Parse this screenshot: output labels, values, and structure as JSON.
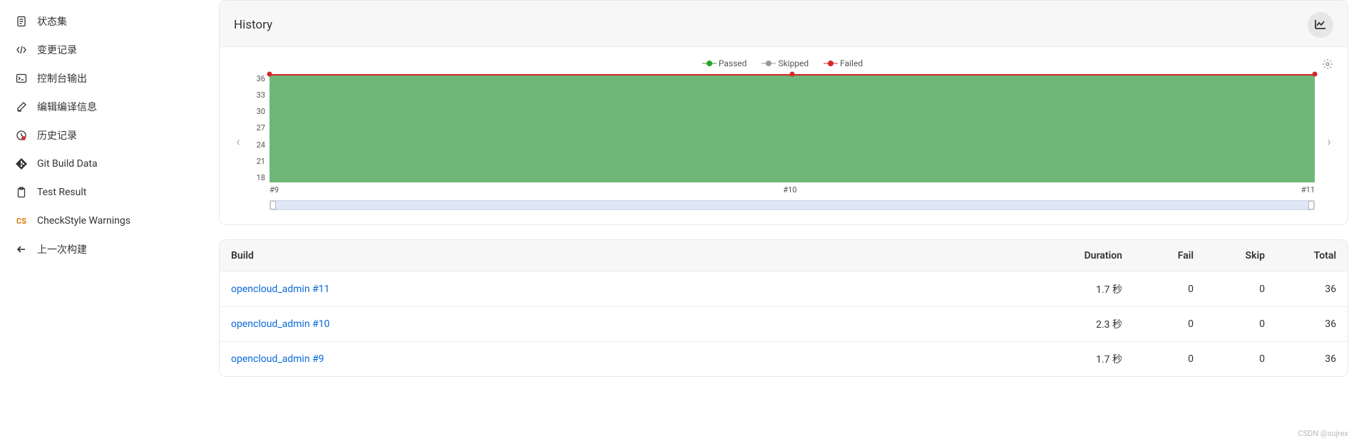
{
  "sidebar": {
    "items": [
      {
        "label": "状态集",
        "icon": "file"
      },
      {
        "label": "变更记录",
        "icon": "code"
      },
      {
        "label": "控制台输出",
        "icon": "terminal"
      },
      {
        "label": "编辑编译信息",
        "icon": "edit"
      },
      {
        "label": "历史记录",
        "icon": "history"
      },
      {
        "label": "Git Build Data",
        "icon": "git"
      },
      {
        "label": "Test Result",
        "icon": "clipboard"
      },
      {
        "label": "CheckStyle Warnings",
        "icon": "cs"
      },
      {
        "label": "上一次构建",
        "icon": "back"
      }
    ]
  },
  "history": {
    "title": "History",
    "legend": {
      "passed": "Passed",
      "skipped": "Skipped",
      "failed": "Failed"
    }
  },
  "chart_data": {
    "type": "area",
    "title": "History",
    "xlabel": "",
    "ylabel": "",
    "x": [
      "#9",
      "#10",
      "#11"
    ],
    "y_ticks": [
      18,
      21,
      24,
      27,
      30,
      33,
      36
    ],
    "ylim": [
      18,
      36
    ],
    "series": [
      {
        "name": "Passed",
        "color": "#2ca02c",
        "values": [
          36,
          36,
          36
        ]
      },
      {
        "name": "Skipped",
        "color": "#999999",
        "values": [
          0,
          0,
          0
        ]
      },
      {
        "name": "Failed",
        "color": "#d62728",
        "values": [
          0,
          0,
          0
        ]
      }
    ]
  },
  "table": {
    "columns": {
      "build": "Build",
      "duration": "Duration",
      "fail": "Fail",
      "skip": "Skip",
      "total": "Total"
    },
    "rows": [
      {
        "build": "opencloud_admin #11",
        "duration": "1.7 秒",
        "fail": "0",
        "skip": "0",
        "total": "36"
      },
      {
        "build": "opencloud_admin #10",
        "duration": "2.3 秒",
        "fail": "0",
        "skip": "0",
        "total": "36"
      },
      {
        "build": "opencloud_admin #9",
        "duration": "1.7 秒",
        "fail": "0",
        "skip": "0",
        "total": "36"
      }
    ]
  },
  "watermark": "CSDN @sujrex"
}
